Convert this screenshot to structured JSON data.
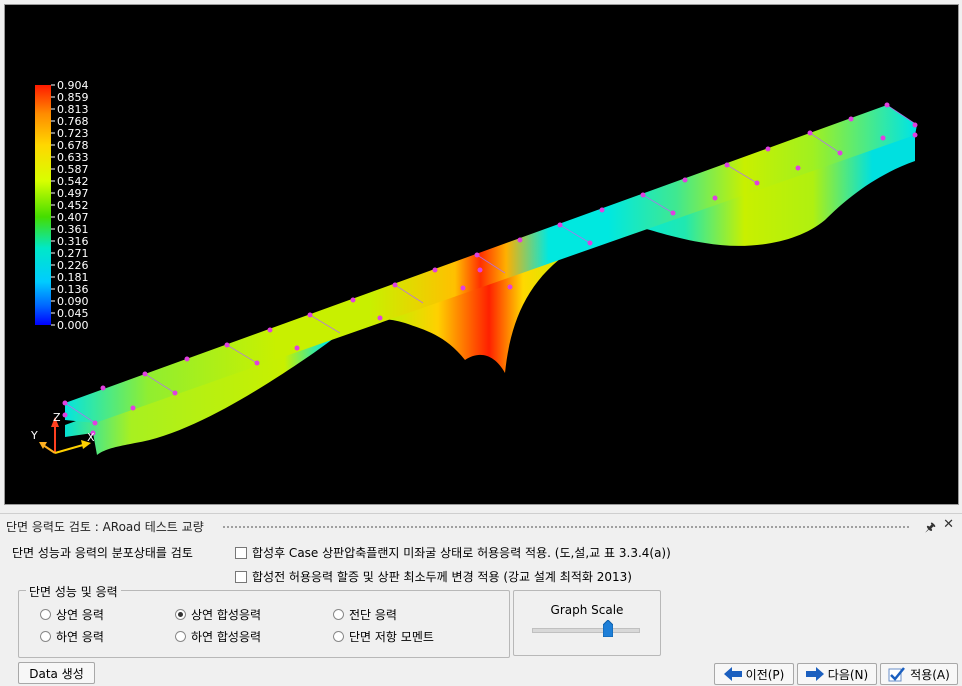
{
  "viewport": {
    "legend_values": [
      "0.904",
      "0.859",
      "0.813",
      "0.768",
      "0.723",
      "0.678",
      "0.633",
      "0.587",
      "0.542",
      "0.497",
      "0.452",
      "0.407",
      "0.361",
      "0.316",
      "0.271",
      "0.226",
      "0.181",
      "0.136",
      "0.090",
      "0.045",
      "0.000"
    ],
    "axis_labels": {
      "z": "Z",
      "y": "Y",
      "x": "X"
    }
  },
  "panel": {
    "title": "단면 응력도 검토 : ARoad 테스트 교량",
    "pin_icon": "pin-icon",
    "close_icon": "close-icon",
    "description": "단면 성능과 응력의 분포상태를 검토",
    "checkbox1": "합성후 Case 상판압축플랜지 미좌굴 상태로 허용응력 적용. (도,설,교 표 3.3.4(a))",
    "checkbox2": "합성전 허용응력 할증 및 상판 최소두께 변경 적용 (강교 설계 최적화 2013)",
    "group_label": "단면 성능 및 응력",
    "radios": [
      "상연 응력",
      "상연 합성응력",
      "전단 응력",
      "하연 응력",
      "하연 합성응력",
      "단면 저항 모멘트"
    ],
    "selected_radio": "상연 합성응력",
    "graph_scale_label": "Graph Scale",
    "graph_scale_value": 0.75
  },
  "buttons": {
    "data": "Data 생성",
    "prev": "이전(P)",
    "next": "다음(N)",
    "apply": "적용(A)"
  }
}
